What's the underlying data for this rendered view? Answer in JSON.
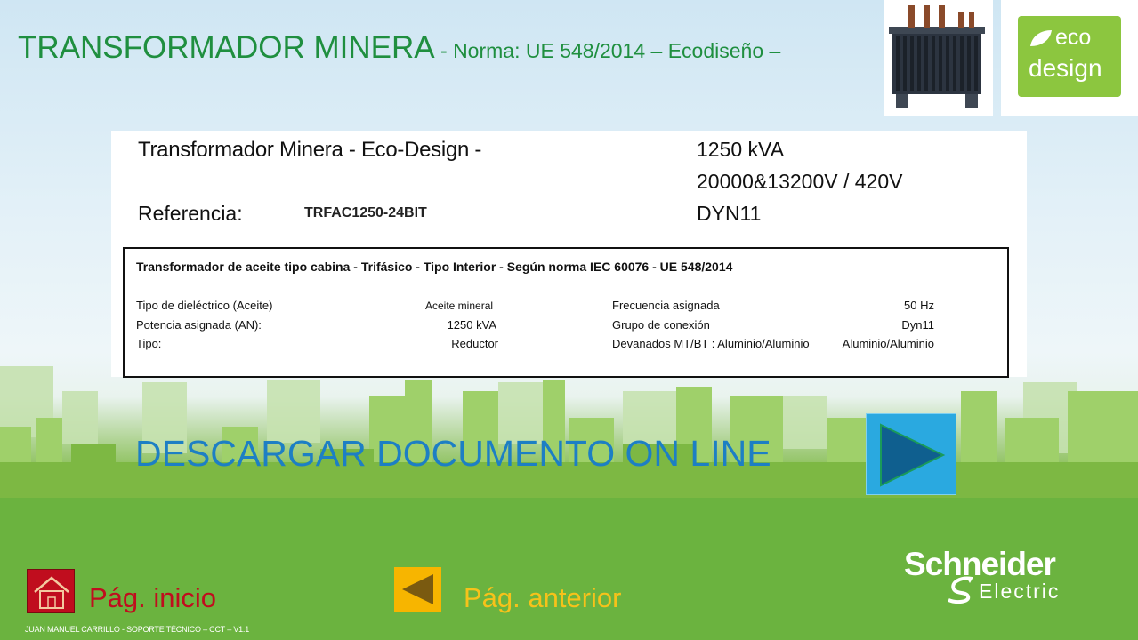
{
  "header": {
    "title_main": "TRANSFORMADOR MINERA",
    "title_sub": " - Norma: UE 548/2014 – Ecodiseño –"
  },
  "eco_badge": {
    "line1": "eco",
    "line2": "design"
  },
  "spec": {
    "heading": "Transformador Minera - Eco-Design  -",
    "rating": "1250 kVA",
    "voltage": "20000&13200V / 420V",
    "connection": "DYN11",
    "reference_label": "Referencia:",
    "reference_value": "TRFAC1250-24BIT",
    "table": {
      "heading": "Transformador de aceite tipo cabina - Trifásico - Tipo Interior - Según norma IEC 60076 - UE 548/2014",
      "rows": [
        {
          "label_left": "Tipo de dieléctrico (Aceite)",
          "value_left": "Aceite mineral",
          "label_right": "Frecuencia asignada",
          "value_right": "50 Hz"
        },
        {
          "label_left": "Potencia asignada (AN):",
          "value_left": "1250  kVA",
          "label_right": "Grupo de conexión",
          "value_right": "Dyn11"
        },
        {
          "label_left": "Tipo:",
          "value_left": "Reductor",
          "label_right": "Devanados MT/BT : Aluminio/Aluminio",
          "value_right": "Aluminio/Aluminio"
        }
      ]
    }
  },
  "actions": {
    "download_label": "DESCARGAR DOCUMENTO ON LINE",
    "home_label": "Pág. inicio",
    "back_label": "Pág. anterior"
  },
  "footer": {
    "credit": "JUAN MANUEL CARRILLO - SOPORTE TÉCNICO – CCT – V1.1"
  },
  "brand": {
    "name_line1": "Schneider",
    "name_line2": "Electric"
  },
  "colors": {
    "title_green": "#1f8f3f",
    "download_blue": "#1d7fc4",
    "play_button": "#2aa9e0",
    "home_red": "#c00d1e",
    "back_yellow": "#f7b500",
    "eco_green": "#8cc63f"
  }
}
